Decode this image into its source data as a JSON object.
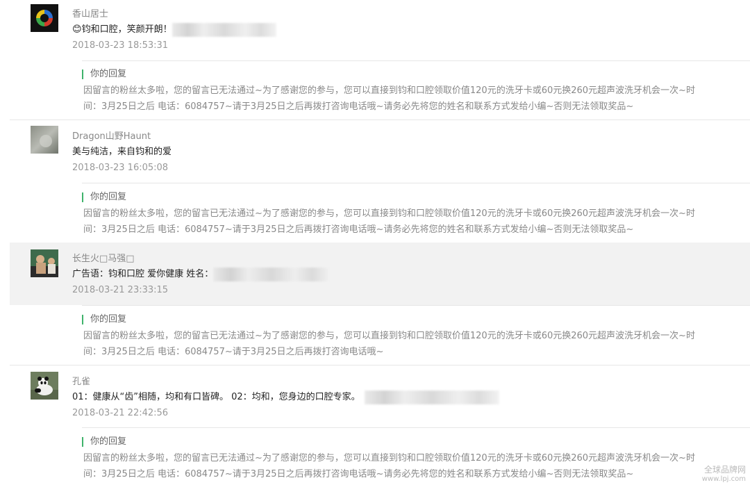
{
  "comments": [
    {
      "nickname": "香山居士",
      "content_emoji": "😊",
      "content": "钧和口腔，笑颜开朗！",
      "time": "2018-03-23 18:53:31",
      "reply_label": "你的回复",
      "reply_text": "因留言的粉丝太多啦，您的留言已无法通过~为了感谢您的参与，您可以直接到钧和口腔领取价值120元的洗牙卡或60元换260元超声波洗牙机会一次~时间：3月25日之后 电话：6084757~请于3月25日之后再拨打咨询电话哦~请务必先将您的姓名和联系方式发给小编~否则无法领取奖品~"
    },
    {
      "nickname": "Dragon山野Haunt",
      "content": "美与纯洁，来自钧和的爱",
      "time": "2018-03-23 16:05:08",
      "reply_label": "你的回复",
      "reply_text": "因留言的粉丝太多啦，您的留言已无法通过~为了感谢您的参与，您可以直接到钧和口腔领取价值120元的洗牙卡或60元换260元超声波洗牙机会一次~时间：3月25日之后 电话：6084757~请于3月25日之后再拨打咨询电话哦~请务必先将您的姓名和联系方式发给小编~否则无法领取奖品~"
    },
    {
      "nickname": "长生火□马强□",
      "content": "广告语：钧和口腔 爱你健康 姓名：",
      "time": "2018-03-21 23:33:15",
      "reply_label": "你的回复",
      "reply_text": "因留言的粉丝太多啦，您的留言已无法通过~为了感谢您的参与，您可以直接到钧和口腔领取价值120元的洗牙卡或60元换260元超声波洗牙机会一次~时间：3月25日之后 电话：6084757~请于3月25日之后再拨打咨询电话哦~"
    },
    {
      "nickname": "孔雀",
      "content": "01：健康从“齿”相随，均和有口皆碑。 02：均和，您身边的口腔专家。",
      "time": "2018-03-21 22:42:56",
      "reply_label": "你的回复",
      "reply_text": "因留言的粉丝太多啦，您的留言已无法通过~为了感谢您的参与，您可以直接到钧和口腔领取价值120元的洗牙卡或60元换260元超声波洗牙机会一次~时间：3月25日之后 电话：6084757~请于3月25日之后再拨打咨询电话哦~请务必先将您的姓名和联系方式发给小编~否则无法领取奖品~"
    }
  ],
  "watermark": {
    "line1": "全球品牌网",
    "line2": "www.lpj.com"
  },
  "colors": {
    "reply_accent": "#3fb36b",
    "highlight_row": "#f2f2f2"
  }
}
